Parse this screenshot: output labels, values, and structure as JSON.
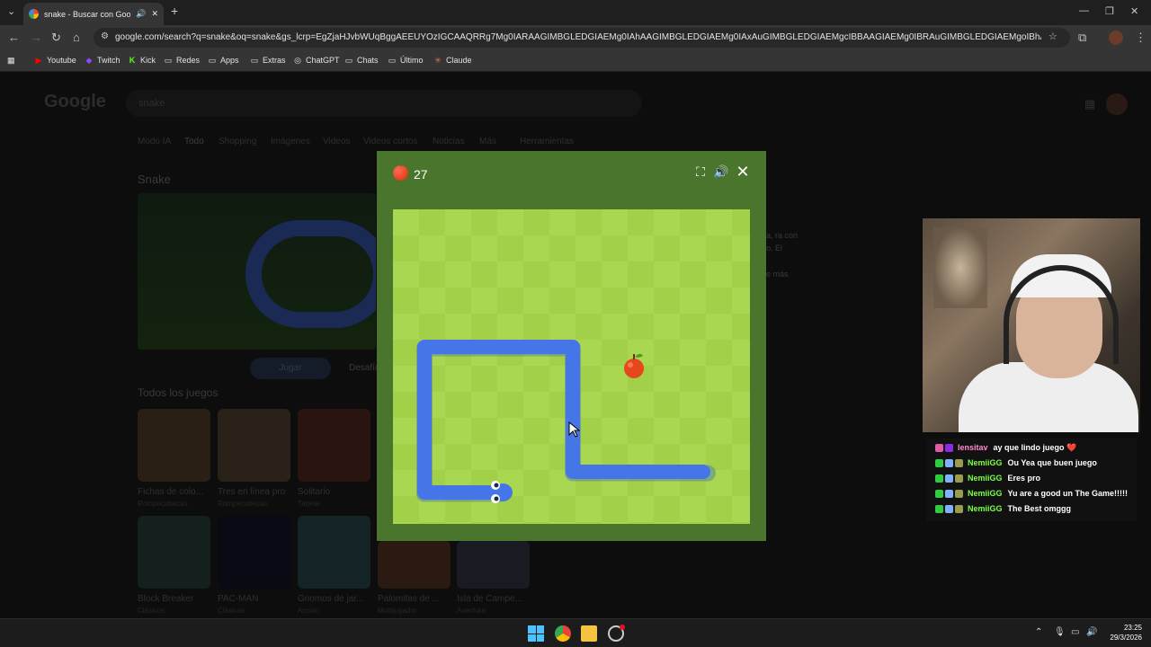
{
  "browser": {
    "tab_title": "snake - Buscar con Google",
    "url": "google.com/search?q=snake&oq=snake&gs_lcrp=EgZjaHJvbWUqBggAEEUYOzIGCAAQRRg7Mg0IARAAGIMBGLEDGIAEMg0IAhAAGIMBGLEDGIAEMg0IAxAuGIMBGLEDGIAEMgcIBBAAGIAEMg0IBRAuGIMBGLEDGIAEMgoIBhAAGLEDGIAEMgcIBxAuGIA...",
    "bookmarks": [
      "Youtube",
      "Twitch",
      "Kick",
      "Redes",
      "Apps",
      "Extras",
      "ChatGPT",
      "Chats",
      "Último",
      "Claude"
    ]
  },
  "page": {
    "logo": "Google",
    "query": "snake",
    "tabs": [
      "Modo IA",
      "Todo",
      "Shopping",
      "Imágenes",
      "Videos",
      "Videos cortos",
      "Noticias",
      "Más",
      "Herramientas"
    ],
    "heading": "Snake",
    "play_button": "Jugar",
    "challenge_button": "Desafío",
    "all_games": "Todos los juegos",
    "side_text": [
      "a, ra con",
      "o. El",
      "",
      "e más"
    ],
    "games": [
      {
        "title": "Fichas de colo...",
        "sub": "Rompecabezas"
      },
      {
        "title": "Tres en línea pro",
        "sub": "Rompecabezas"
      },
      {
        "title": "Solitario",
        "sub": "Tarjeta"
      },
      {
        "title": "Block Breaker",
        "sub": "Clásicos"
      },
      {
        "title": "PAC-MAN",
        "sub": "Clásicos"
      },
      {
        "title": "Gnomos de jar...",
        "sub": "Acción"
      },
      {
        "title": "Palomitas de ...",
        "sub": "Multijugador"
      },
      {
        "title": "Isla de Campe...",
        "sub": "Aventura"
      }
    ]
  },
  "game": {
    "score": "27",
    "icons": [
      "fullscreen-icon",
      "volume-icon",
      "close-icon"
    ],
    "colors": {
      "snake": "#4675e8",
      "frame": "#4a752c",
      "board_light": "#aad751",
      "board_dark": "#a2d149",
      "apple": "#e7471d"
    }
  },
  "chat": [
    {
      "user": "lensitav",
      "msg": "ay que lindo juego ❤️",
      "color": "#ff8ad0"
    },
    {
      "user": "NemiiGG",
      "msg": "Ou Yea que buen juego",
      "color": "#7cff4a"
    },
    {
      "user": "NemiiGG",
      "msg": "Eres pro",
      "color": "#7cff4a"
    },
    {
      "user": "NemiiGG",
      "msg": "Yu are a good un The Game!!!!!",
      "color": "#7cff4a"
    },
    {
      "user": "NemiiGG",
      "msg": "The Best omggg",
      "color": "#7cff4a"
    }
  ],
  "taskbar": {
    "time": "23:25",
    "date": "29/3/2026"
  }
}
